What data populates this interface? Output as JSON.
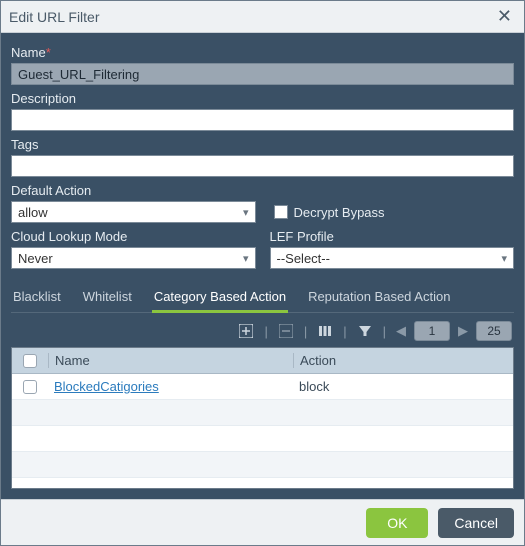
{
  "dialog": {
    "title": "Edit URL Filter"
  },
  "fields": {
    "name": {
      "label": "Name",
      "value": "Guest_URL_Filtering"
    },
    "description": {
      "label": "Description",
      "value": ""
    },
    "tags": {
      "label": "Tags",
      "value": ""
    },
    "default_action": {
      "label": "Default Action",
      "value": "allow"
    },
    "decrypt_bypass": {
      "label": "Decrypt Bypass"
    },
    "cloud_lookup": {
      "label": "Cloud Lookup Mode",
      "value": "Never"
    },
    "lef_profile": {
      "label": "LEF Profile",
      "value": "--Select--"
    }
  },
  "tabs": {
    "blacklist": "Blacklist",
    "whitelist": "Whitelist",
    "category": "Category Based Action",
    "reputation": "Reputation Based Action"
  },
  "toolbar": {
    "page_current": "1",
    "page_size": "25"
  },
  "table": {
    "headers": {
      "name": "Name",
      "action": "Action"
    },
    "rows": [
      {
        "name": "BlockedCatigories",
        "action": "block"
      }
    ]
  },
  "footer": {
    "ok": "OK",
    "cancel": "Cancel"
  }
}
